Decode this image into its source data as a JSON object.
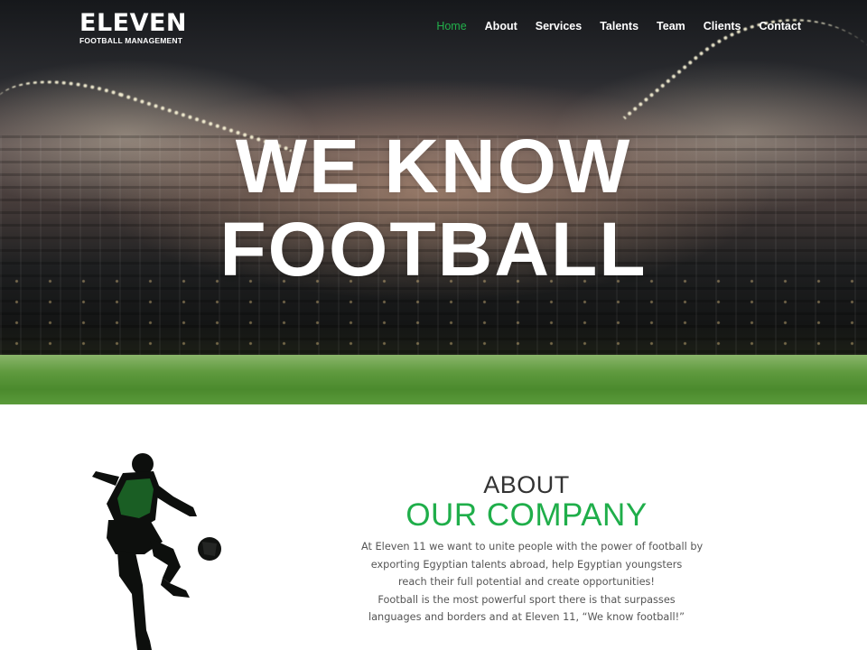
{
  "logo": {
    "name": "ELEVEN",
    "tagline": "FOOTBALL MANAGEMENT"
  },
  "nav": {
    "items": [
      {
        "label": "Home",
        "active": true
      },
      {
        "label": "About",
        "active": false
      },
      {
        "label": "Services",
        "active": false
      },
      {
        "label": "Talents",
        "active": false
      },
      {
        "label": "Team",
        "active": false
      },
      {
        "label": "Clients",
        "active": false
      },
      {
        "label": "Contact",
        "active": false
      }
    ]
  },
  "hero": {
    "line1": "WE KNOW",
    "line2": "FOOTBALL"
  },
  "about": {
    "heading1": "ABOUT",
    "heading2": "OUR COMPANY",
    "paragraph_lines": [
      "At Eleven 11 we want to unite people with the power of football by",
      "exporting Egyptian talents abroad, help Egyptian youngsters",
      "reach their full potential and create opportunities!",
      "Football is the most powerful sport there is that surpasses",
      "languages and borders and at Eleven 11, “We know football!”"
    ]
  },
  "colors": {
    "accent": "#1fae4a",
    "text": "#555555",
    "heading": "#333333"
  },
  "icons": {
    "player_image": "football-player-kick-silhouette"
  }
}
